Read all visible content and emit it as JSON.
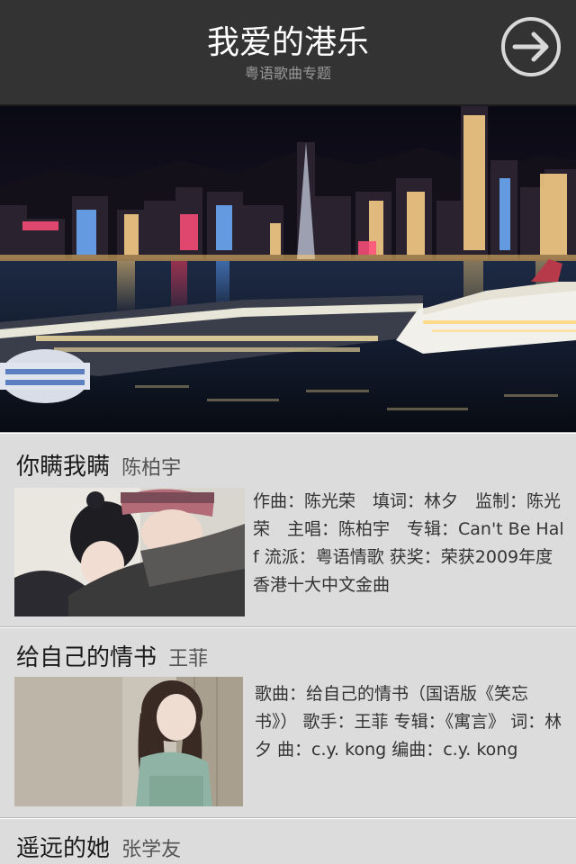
{
  "header": {
    "title": "我爱的港乐",
    "subtitle": "粤语歌曲专题",
    "next_icon": "arrow-right-circle-icon"
  },
  "banner": {
    "image": "hong-kong-victoria-harbour-night-photo"
  },
  "songs": [
    {
      "name": "你瞒我瞒",
      "artist": "陈柏宇",
      "description": "作曲：陈光荣　填词：林夕　监制：陈光荣　主唱：陈柏宇　专辑：Can't Be Half  流派：粤语情歌 获奖：荣获2009年度香港十大中文金曲",
      "thumb": "couple-winter-photo"
    },
    {
      "name": "给自己的情书",
      "artist": "王菲",
      "description": "歌曲：给自己的情书（国语版《笑忘书》）  歌手：王菲 专辑：《寓言》 词：林夕 曲：c.y. kong 编曲：c.y. kong",
      "thumb": "girl-leaning-wall-photo"
    },
    {
      "name": "遥远的她",
      "artist": "张学友",
      "description": "",
      "thumb": ""
    }
  ]
}
